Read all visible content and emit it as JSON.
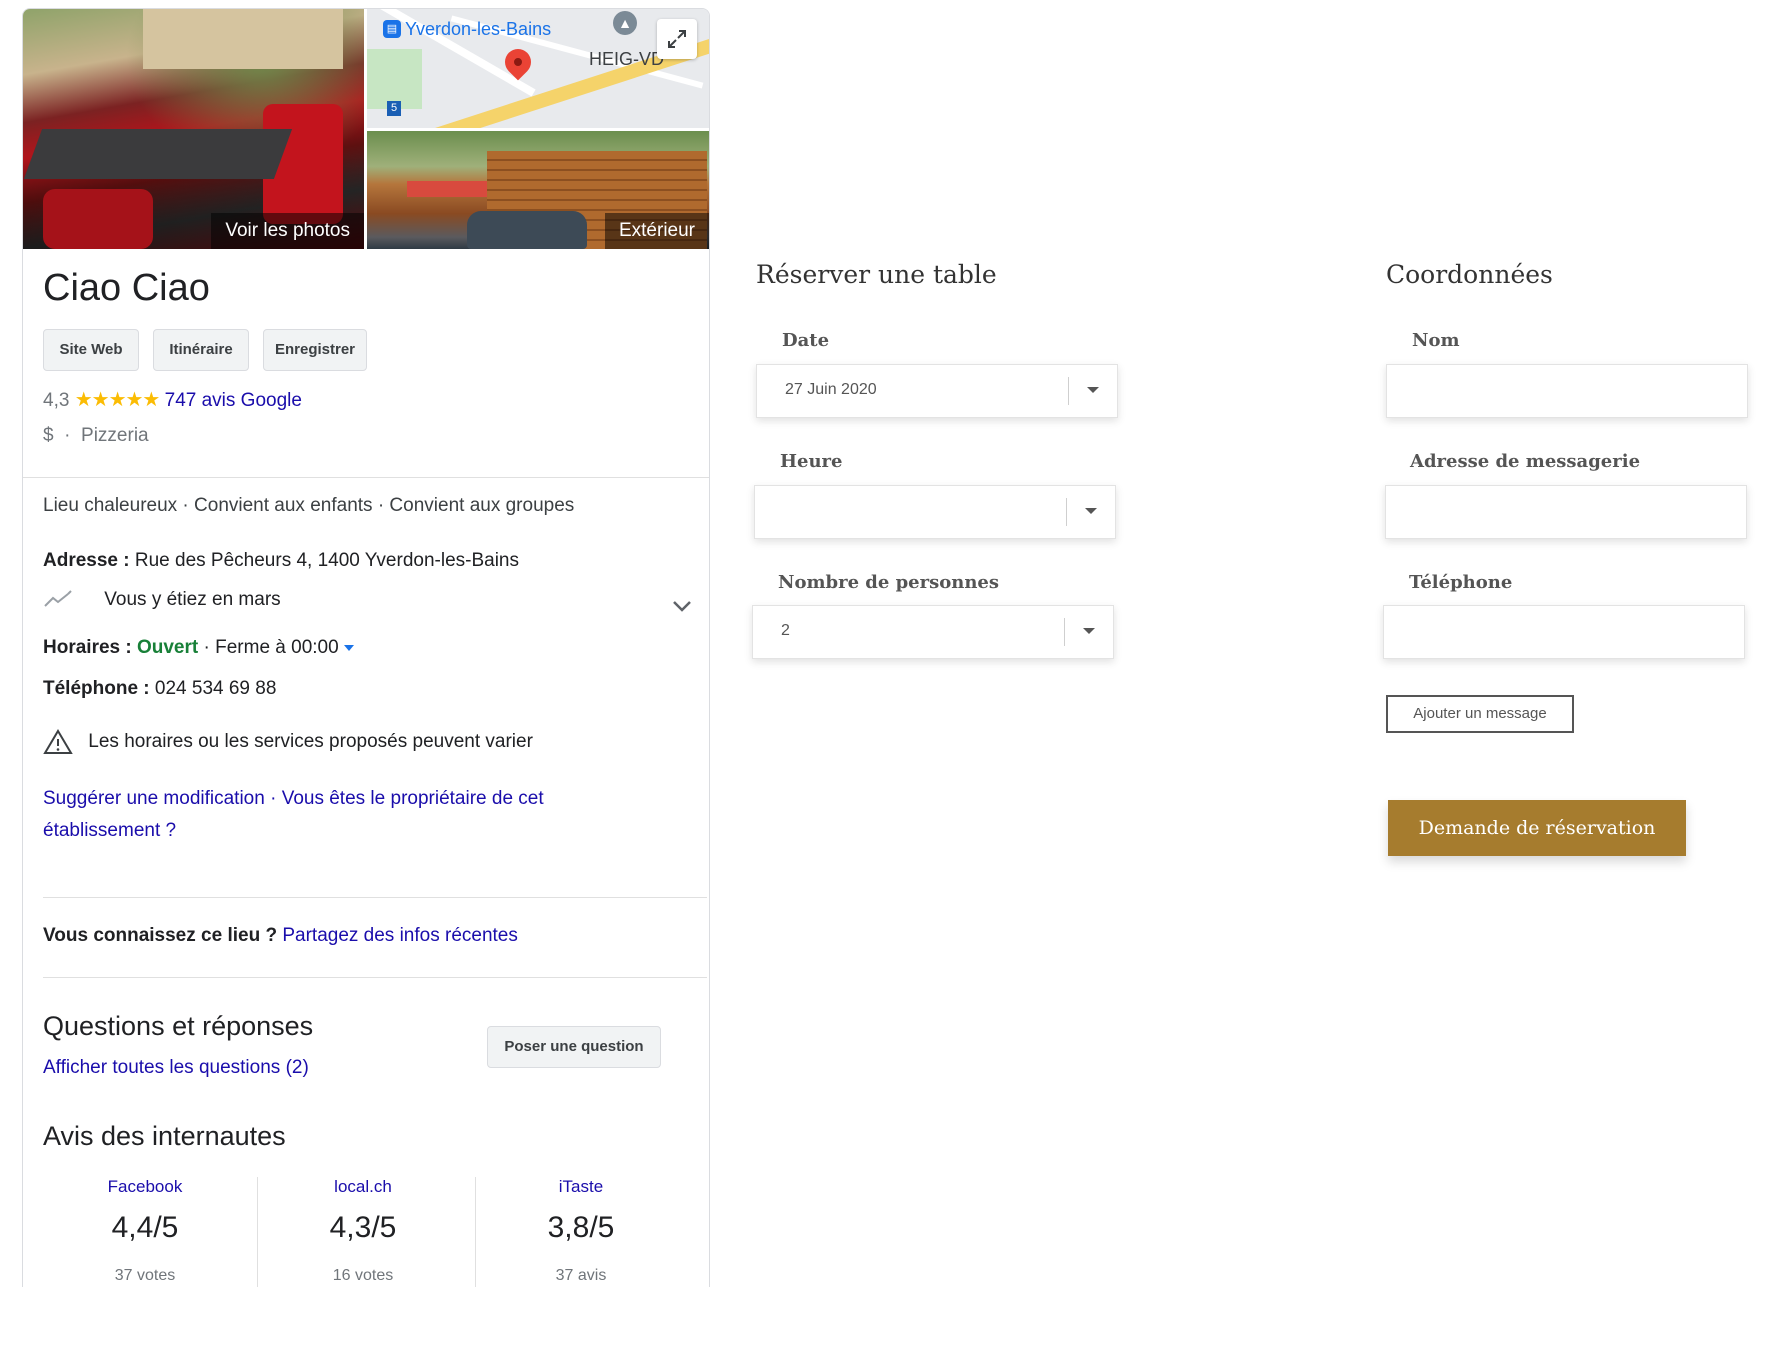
{
  "panel": {
    "photos": {
      "main_caption": "Voir les photos",
      "map_station_label": "Yverdon-les-Bains",
      "map_poi_label": "HEIG-VD",
      "map_route_badge": "5",
      "exterior_caption": "Extérieur"
    },
    "title": "Ciao Ciao",
    "buttons": {
      "website": "Site Web",
      "directions": "Itinéraire",
      "save": "Enregistrer"
    },
    "rating": {
      "value": "4,3",
      "stars": "★★★★★",
      "reviews_link": "747 avis Google"
    },
    "price": "$",
    "separator": "·",
    "category": "Pizzeria",
    "attributes": "Lieu chaleureux · Convient aux enfants · Convient aux groupes",
    "address": {
      "label": "Adresse :",
      "value": "Rue des Pêcheurs 4, 1400 Yverdon-les-Bains"
    },
    "visit": {
      "text": "Vous y étiez en mars"
    },
    "hours": {
      "label": "Horaires :",
      "status": "Ouvert",
      "detail": "· Ferme à 00:00"
    },
    "phone": {
      "label": "Téléphone :",
      "value": "024 534 69 88"
    },
    "warning": "Les horaires ou les services proposés peuvent varier",
    "suggest": {
      "edit_link": "Suggérer une modification",
      "sep": "·",
      "owner_link": "Vous êtes le propriétaire de cet établissement ?"
    },
    "know_place": {
      "label": "Vous connaissez ce lieu ?",
      "link": "Partagez des infos récentes"
    },
    "qa": {
      "title": "Questions et réponses",
      "link": "Afficher toutes les questions (2)",
      "ask_button": "Poser une question"
    },
    "reviews": {
      "title": "Avis des internautes",
      "sources": [
        {
          "name": "Facebook",
          "score": "4,4/5",
          "count": "37 votes"
        },
        {
          "name": "local.ch",
          "score": "4,3/5",
          "count": "16 votes"
        },
        {
          "name": "iTaste",
          "score": "3,8/5",
          "count": "37 avis"
        }
      ]
    }
  },
  "booking": {
    "title": "Réserver une table",
    "date": {
      "label": "Date",
      "value": "27 Juin 2020"
    },
    "time": {
      "label": "Heure",
      "value": ""
    },
    "people": {
      "label": "Nombre de personnes",
      "value": "2"
    }
  },
  "contact": {
    "title": "Coordonnées",
    "name": {
      "label": "Nom",
      "value": ""
    },
    "email": {
      "label": "Adresse de messagerie",
      "value": ""
    },
    "phone": {
      "label": "Téléphone",
      "value": ""
    },
    "add_message": "Ajouter un message",
    "submit": "Demande de réservation"
  },
  "colors": {
    "accent_gold": "#a67c2e",
    "link_blue": "#1a0dab",
    "open_green": "#188038",
    "star_yellow": "#fbbc04"
  }
}
